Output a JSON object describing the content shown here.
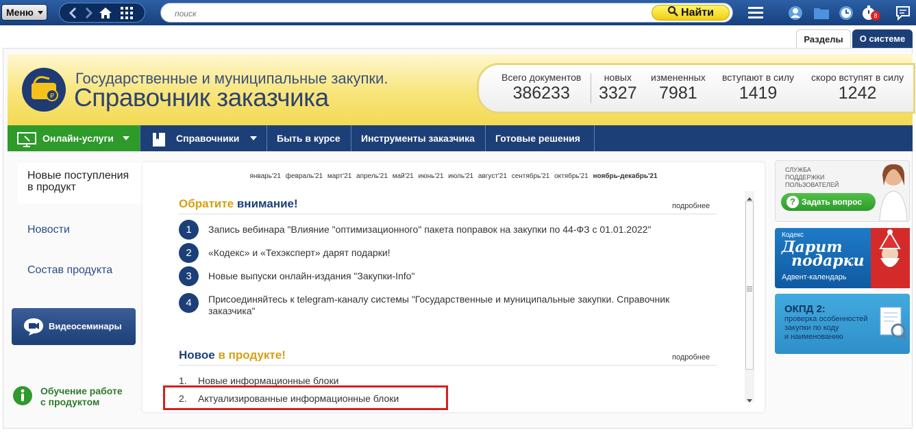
{
  "topbar": {
    "menu_label": "Меню",
    "search_placeholder": "поиск",
    "find_label": "Найти",
    "badge_count": "8"
  },
  "tabs": {
    "sections": "Разделы",
    "about": "О системе"
  },
  "header": {
    "title_line1": "Государственные и муниципальные закупки.",
    "title_line2": "Справочник заказчика",
    "stats": [
      {
        "label": "Всего документов",
        "value": "386233"
      },
      {
        "label": "новых",
        "value": "3327"
      },
      {
        "label": "измененных",
        "value": "7981"
      },
      {
        "label": "вступают в силу",
        "value": "1419"
      },
      {
        "label": "скоро вступят в силу",
        "value": "1242"
      }
    ]
  },
  "nav": {
    "items": [
      "Онлайн-услуги",
      "Справочники",
      "Быть в курсе",
      "Инструменты заказчика",
      "Готовые решения"
    ]
  },
  "sidebar": {
    "active_line1": "Новые поступления",
    "active_line2": "в продукт",
    "news": "Новости",
    "composition": "Состав продукта",
    "video": "Видеосеминары",
    "learn_line1": "Обучение работе",
    "learn_line2": "с продуктом"
  },
  "months": [
    "январь'21",
    "февраль'21",
    "март'21",
    "апрель'21",
    "май'21",
    "июнь'21",
    "июль'21",
    "август'21",
    "сентябрь'21",
    "октябрь'21",
    "ноябрь-декабрь'21"
  ],
  "attention": {
    "title_part1": "Обратите",
    "title_part2": "внимание!",
    "more": "подробнее",
    "items": [
      {
        "n": "1",
        "text": "Запись вебинара \"Влияние \"оптимизационного\" пакета поправок на закупки по 44-ФЗ с 01.01.2022\""
      },
      {
        "n": "2",
        "text": "«Кодекс» и «Техэксперт» дарят подарки!"
      },
      {
        "n": "3",
        "text": "Новые выпуски онлайн-издания \"Закупки-Info\""
      },
      {
        "n": "4",
        "line1": "Присоединяйтесь к telegram-каналу системы \"Государственные и муниципальные закупки. Справочник",
        "line2": "заказчика\""
      }
    ]
  },
  "new_in_product": {
    "title_part1": "Новое",
    "title_part2": "в продукте!",
    "more": "подробнее",
    "items": [
      {
        "n": "1.",
        "text": "Новые информационные блоки"
      },
      {
        "n": "2.",
        "text": "Актуализированные информационные блоки"
      }
    ]
  },
  "right": {
    "support_line1": "СЛУЖБА",
    "support_line2": "ПОДДЕРЖКИ",
    "support_line3": "ПОЛЬЗОВАТЕЛЕЙ",
    "ask_button": "Задать вопрос",
    "gift_brand": "Кодекс",
    "gift_line1": "Дарит",
    "gift_line2": "подарки",
    "gift_caption": "Адвент-календарь",
    "okpd_title": "ОКПД 2:",
    "okpd_line1": "проверка особенностей",
    "okpd_line2": "закупки по коду",
    "okpd_line3": "и наименованию"
  },
  "colors": {
    "navy": "#1d3f78",
    "green": "#2d9a2a",
    "gold": "#d4a012",
    "highlight": "#d91d1d"
  }
}
